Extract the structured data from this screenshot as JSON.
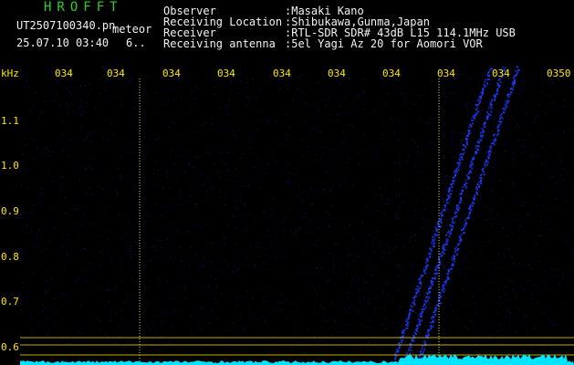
{
  "header": {
    "program": "HROFFT",
    "filename": "UT2507100340.pn",
    "type_label": "meteor",
    "datetime": "25.07.10 03:40",
    "trail": "6..",
    "fields": [
      {
        "label": "Observer",
        "value": ":Masaki Kano"
      },
      {
        "label": "Receiving Location",
        "value": ":Shibukawa,Gunma,Japan"
      },
      {
        "label": "Receiver",
        "value": ":RTL-SDR SDR# 43dB L15 114.1MHz USB"
      },
      {
        "label": "Receiving antenna",
        "value": ":5el Yagi Az 20 for Aomori VOR"
      }
    ]
  },
  "spectrogram": {
    "unit_label": "kHz",
    "time_labels": [
      "034",
      "034",
      "034",
      "034",
      "034",
      "034",
      "034",
      "034",
      "034",
      "0350"
    ],
    "freq_labels": [
      "1.1",
      "1.0",
      "0.9",
      "0.8",
      "0.7",
      "0.6"
    ],
    "colors": {
      "background": "#000000",
      "signal": "#1e3cff",
      "noise_floor": "#00e5ff",
      "grid": "#ffe600",
      "marker": "#ffff66"
    }
  }
}
